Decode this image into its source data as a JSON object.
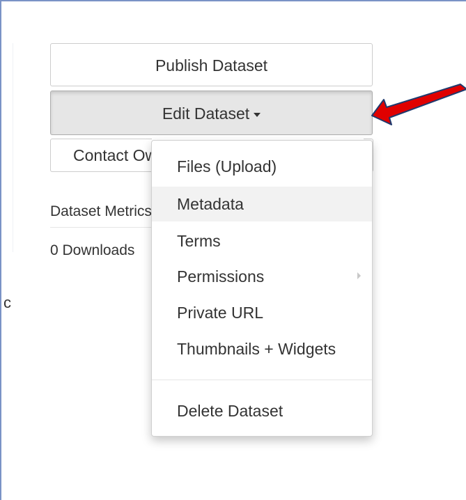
{
  "buttons": {
    "publish": "Publish Dataset",
    "edit": "Edit Dataset",
    "contact": "Contact Owner"
  },
  "metrics": {
    "title": "Dataset Metrics",
    "downloads": "0 Downloads"
  },
  "edge_text": "c",
  "menu": {
    "items": [
      {
        "label": "Files (Upload)"
      },
      {
        "label": "Metadata"
      },
      {
        "label": "Terms"
      },
      {
        "label": "Permissions"
      },
      {
        "label": "Private URL"
      },
      {
        "label": "Thumbnails + Widgets"
      },
      {
        "label": "Delete Dataset"
      }
    ]
  },
  "colors": {
    "arrow": "#e00000",
    "highlight": "#f2f2f2",
    "frame_border": "#7a93c6"
  },
  "icons": [
    "caret-down-icon",
    "chevron-right-icon",
    "red-arrow-icon"
  ]
}
